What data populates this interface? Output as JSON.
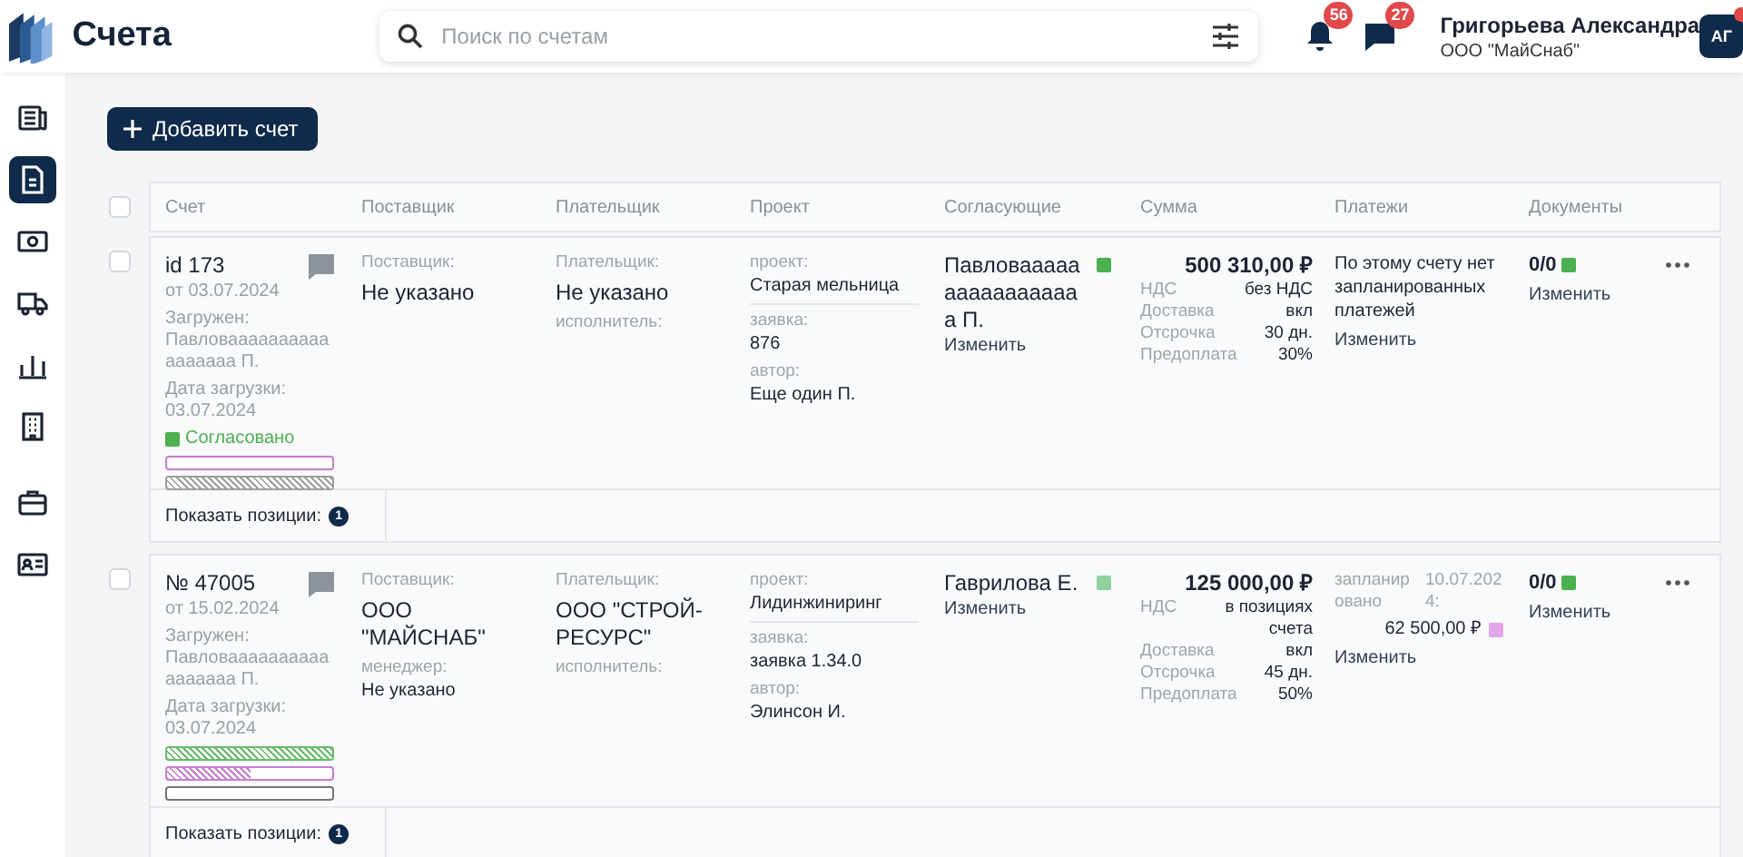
{
  "header": {
    "title": "Счета",
    "search": {
      "placeholder": "Поиск по счетам"
    },
    "notifications": {
      "count": "56"
    },
    "messages": {
      "count": "27"
    },
    "user": {
      "name": "Григорьева Александра",
      "company": "ООО \"МайСнаб\"",
      "initials": "АГ"
    }
  },
  "sidebar": {
    "items": [
      {
        "selected": false
      },
      {
        "selected": true
      },
      {
        "selected": false
      },
      {
        "selected": false
      },
      {
        "selected": false
      },
      {
        "selected": false
      },
      {
        "selected": false
      },
      {
        "selected": false
      }
    ]
  },
  "add_button": "Добавить счет",
  "table": {
    "select_all": false,
    "columns": [
      "Счет",
      "Поставщик",
      "Плательщик",
      "Проект",
      "Согласующие",
      "Сумма",
      "Платежи",
      "Документы"
    ],
    "rows": [
      {
        "selected": false,
        "number": "id 173",
        "date": "от 03.07.2024",
        "uploaded_label": "Загружен:",
        "uploaded_by": "Павловааааааааааааааааа П.",
        "upload_date_label": "Дата загрузки:",
        "upload_date": "03.07.2024",
        "status": {
          "label": "Согласовано",
          "color": "#4caf50"
        },
        "bars": [
          {
            "color": "#c77dcc",
            "level": 0
          },
          {
            "color": "#9e9e9e",
            "level": 1
          }
        ],
        "supplier": {
          "label": "Поставщик:",
          "value": "Не указано"
        },
        "payer": {
          "label": "Плательщик:",
          "value": "Не указано",
          "executor_label": "исполнитель:"
        },
        "project": {
          "label": "проект:",
          "value": "Старая мельница",
          "request_label": "заявка:",
          "request": "876",
          "author_label": "автор:",
          "author": "Еще один П."
        },
        "approver": {
          "name": "Павловааааааааааааааааа П.",
          "color": "#4caf50",
          "action": "Изменить"
        },
        "sum": {
          "amount": "500 310,00 ₽",
          "details": [
            {
              "label": "НДС",
              "value": "без НДС"
            },
            {
              "label": "Доставка",
              "value": "вкл"
            },
            {
              "label": "Отсрочка",
              "value": "30 дн."
            },
            {
              "label": "Предоплата",
              "value": "30%"
            }
          ]
        },
        "payments": {
          "kind": "none",
          "text": "По этому счету нет запланированных платежей",
          "action": "Изменить"
        },
        "documents": {
          "count": "0/0",
          "color": "#4caf50",
          "action": "Изменить"
        },
        "positions": {
          "label": "Показать позиции:",
          "count": "1"
        }
      },
      {
        "selected": false,
        "number": "№ 47005",
        "date": "от 15.02.2024",
        "uploaded_label": "Загружен:",
        "uploaded_by": "Павловааааааааааааааааа П.",
        "upload_date_label": "Дата загрузки:",
        "upload_date": "03.07.2024",
        "bars": [
          {
            "color": "#66bb6a",
            "level": 1
          },
          {
            "color": "#c77dcc",
            "level": 0.5
          },
          {
            "color": "#757575",
            "level": 0
          }
        ],
        "supplier": {
          "label": "Поставщик:",
          "value": "ООО \"МАЙСНАБ\"",
          "manager_label": "менеджер:",
          "manager": "Не указано"
        },
        "payer": {
          "label": "Плательщик:",
          "value": "ООО \"СТРОЙ-РЕСУРС\"",
          "executor_label": "исполнитель:"
        },
        "project": {
          "label": "проект:",
          "value": "Лидинжиниринг",
          "request_label": "заявка:",
          "request": "заявка 1.34.0",
          "author_label": "автор:",
          "author": "Элинсон И."
        },
        "approver": {
          "name": "Гаврилова Е.",
          "color": "#8fd19e",
          "action": "Изменить"
        },
        "sum": {
          "amount": "125 000,00 ₽",
          "details": [
            {
              "label": "НДС",
              "value": "в позициях счета"
            },
            {
              "label": "Доставка",
              "value": "вкл"
            },
            {
              "label": "Отсрочка",
              "value": "45 дн."
            },
            {
              "label": "Предоплата",
              "value": "50%"
            }
          ]
        },
        "payments": {
          "kind": "scheduled",
          "label": "запланировано",
          "date": "10.07.2024:",
          "amount": "62 500,00 ₽",
          "color": "#e1a5e8",
          "action": "Изменить"
        },
        "documents": {
          "count": "0/0",
          "color": "#4caf50",
          "action": "Изменить"
        },
        "positions": {
          "label": "Показать позиции:",
          "count": "1"
        }
      }
    ]
  }
}
